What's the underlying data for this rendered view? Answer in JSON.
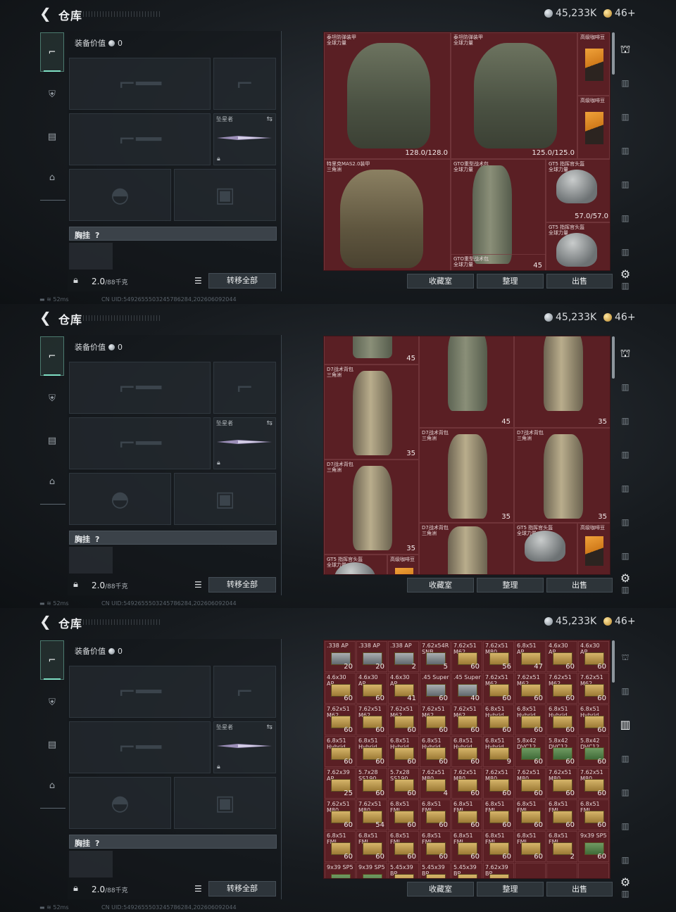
{
  "header": {
    "title": "仓库",
    "currency_silver": "45,233K",
    "currency_gold": "46+"
  },
  "equipment": {
    "value_label": "装备价值",
    "value": "0",
    "melee_label": "坠星者",
    "chest_label": "胸挂",
    "chest_hint": "?",
    "capacity": "2.0",
    "capacity_max": "/88千克",
    "transfer_all": "转移全部"
  },
  "status": {
    "ping": "52ms",
    "uid": "CN UID:5492655503245786284,202606092044"
  },
  "actions": {
    "collection": "收藏室",
    "sort": "整理",
    "sell": "出售"
  },
  "panel0": {
    "items": [
      {
        "name": "泰坦防弹装甲\n全球力量",
        "durability": "128.0/128.0"
      },
      {
        "name": "泰坦防弹装甲\n全球力量",
        "durability": "125.0/125.0"
      },
      {
        "name": "高级咖啡豆"
      },
      {
        "name": "高级咖啡豆"
      },
      {
        "name": "特里克MAS2.0装甲\n三角洲"
      },
      {
        "name": "GTO重型战术包\n全球力量",
        "count": "45"
      },
      {
        "name": "GT5 指挥官头盔\n全球力量",
        "durability": "57.0/57.0"
      },
      {
        "name": "GT5 指挥官头盔\n全球力量"
      },
      {
        "name": "GTO重型战术包\n全球力量"
      }
    ]
  },
  "panel1": {
    "items": [
      {
        "name": "",
        "count": "45"
      },
      {
        "name": "GTO重型战术包\n全球力量",
        "count": "45"
      },
      {
        "name": "D7战术背包\n三角洲",
        "count": "35"
      },
      {
        "name": "D7战术背包\n三角洲",
        "count": "35"
      },
      {
        "name": "D7战术背包\n三角洲",
        "count": "35"
      },
      {
        "name": "D7战术背包\n三角洲",
        "count": "35"
      },
      {
        "name": "D7战术背包\n三角洲",
        "count": "35"
      },
      {
        "name": "D7战术背包\n三角洲",
        "count": "35"
      },
      {
        "name": "GT5 指挥官头盔\n全球力量"
      },
      {
        "name": "高级咖啡豆"
      },
      {
        "name": "GT5 指挥官头盔\n全球力量"
      },
      {
        "name": "高级咖啡豆"
      }
    ]
  },
  "panel2": {
    "rows": [
      [
        [
          ".338\nAP",
          "20"
        ],
        [
          ".338\nAP",
          "20"
        ],
        [
          ".338\nAP",
          "2"
        ],
        [
          "7.62x54R\nSNB",
          "5"
        ],
        [
          "7.62x51\nM62",
          "60"
        ],
        [
          "7.62x51\nM80",
          "56"
        ],
        [
          "6.8x51\nAP",
          "47"
        ],
        [
          "4.6x30\nAP",
          "60"
        ],
        [
          "4.6x30\nAP",
          "60"
        ]
      ],
      [
        [
          "4.6x30\nAP",
          "60"
        ],
        [
          "4.6x30\nAP",
          "60"
        ],
        [
          "4.6x30\nAP",
          "41"
        ],
        [
          ".45\nSuper",
          "60"
        ],
        [
          ".45\nSuper",
          "40"
        ],
        [
          "7.62x51\nM62",
          "60"
        ],
        [
          "7.62x51\nM62",
          "60"
        ],
        [
          "7.62x51\nM62",
          "60"
        ],
        [
          "7.62x51\nM62",
          "60"
        ]
      ],
      [
        [
          "7.62x51\nM62",
          "60"
        ],
        [
          "7.62x51\nM62",
          "60"
        ],
        [
          "7.62x51\nM62",
          "60"
        ],
        [
          "7.62x51\nM62",
          "60"
        ],
        [
          "7.62x51\nM62",
          "60"
        ],
        [
          "6.8x51\nHybrid",
          "60"
        ],
        [
          "6.8x51\nHybrid",
          "60"
        ],
        [
          "6.8x51\nHybrid",
          "60"
        ],
        [
          "6.8x51\nHybrid",
          "60"
        ]
      ],
      [
        [
          "6.8x51\nHybrid",
          "60"
        ],
        [
          "6.8x51\nHybrid",
          "60"
        ],
        [
          "6.8x51\nHybrid",
          "60"
        ],
        [
          "6.8x51\nHybrid",
          "60"
        ],
        [
          "6.8x51\nHybrid",
          "60"
        ],
        [
          "6.8x51\nHybrid",
          "9"
        ],
        [
          "5.8x42\nDVC12",
          "60"
        ],
        [
          "5.8x42\nDVC12",
          "60"
        ],
        [
          "5.8x42\nDVC12",
          "60"
        ]
      ],
      [
        [
          "7.62x39\nAP",
          "25"
        ],
        [
          "5.7x28\nSS190",
          "60"
        ],
        [
          "5.7x28\nSS190",
          "60"
        ],
        [
          "7.62x51\nM80",
          "4"
        ],
        [
          "7.62x51\nM80",
          "60"
        ],
        [
          "7.62x51\nM80",
          "60"
        ],
        [
          "7.62x51\nM80",
          "60"
        ],
        [
          "7.62x51\nM80",
          "60"
        ],
        [
          "7.62x51\nM80",
          "60"
        ]
      ],
      [
        [
          "7.62x51\nM80",
          "60"
        ],
        [
          "7.62x51\nM80",
          "54"
        ],
        [
          "6.8x51\nFMJ",
          "60"
        ],
        [
          "6.8x51\nFMJ",
          "60"
        ],
        [
          "6.8x51\nFMJ",
          "60"
        ],
        [
          "6.8x51\nFMJ",
          "60"
        ],
        [
          "6.8x51\nFMJ",
          "60"
        ],
        [
          "6.8x51\nFMJ",
          "60"
        ],
        [
          "6.8x51\nFMJ",
          "60"
        ]
      ],
      [
        [
          "6.8x51\nFMJ",
          "60"
        ],
        [
          "6.8x51\nFMJ",
          "60"
        ],
        [
          "6.8x51\nFMJ",
          "60"
        ],
        [
          "6.8x51\nFMJ",
          "60"
        ],
        [
          "6.8x51\nFMJ",
          "60"
        ],
        [
          "6.8x51\nFMJ",
          "60"
        ],
        [
          "6.8x51\nFMJ",
          "60"
        ],
        [
          "6.8x51\nFMJ",
          "2"
        ],
        [
          "9x39\nSP5",
          "60"
        ]
      ],
      [
        [
          "9x39\nSP5",
          ""
        ],
        [
          "9x39\nSP5",
          ""
        ],
        [
          "5.45x39\nBP",
          ""
        ],
        [
          "5.45x39\nBP",
          ""
        ],
        [
          "5.45x39\nBP",
          ""
        ],
        [
          "7.62x39\nBP",
          ""
        ],
        [
          "",
          "",
          ""
        ],
        [
          "",
          ""
        ],
        [
          "",
          ""
        ]
      ]
    ]
  },
  "colors": {
    "stash_bg": "#5a1f24",
    "accent_teal": "#7fe0c5",
    "panel_bg": "#171b1f"
  },
  "icons": {
    "back": "chevron-left-icon",
    "silver": "silver-coin-icon",
    "gold": "gold-coin-icon",
    "settings": "gear-icon"
  }
}
